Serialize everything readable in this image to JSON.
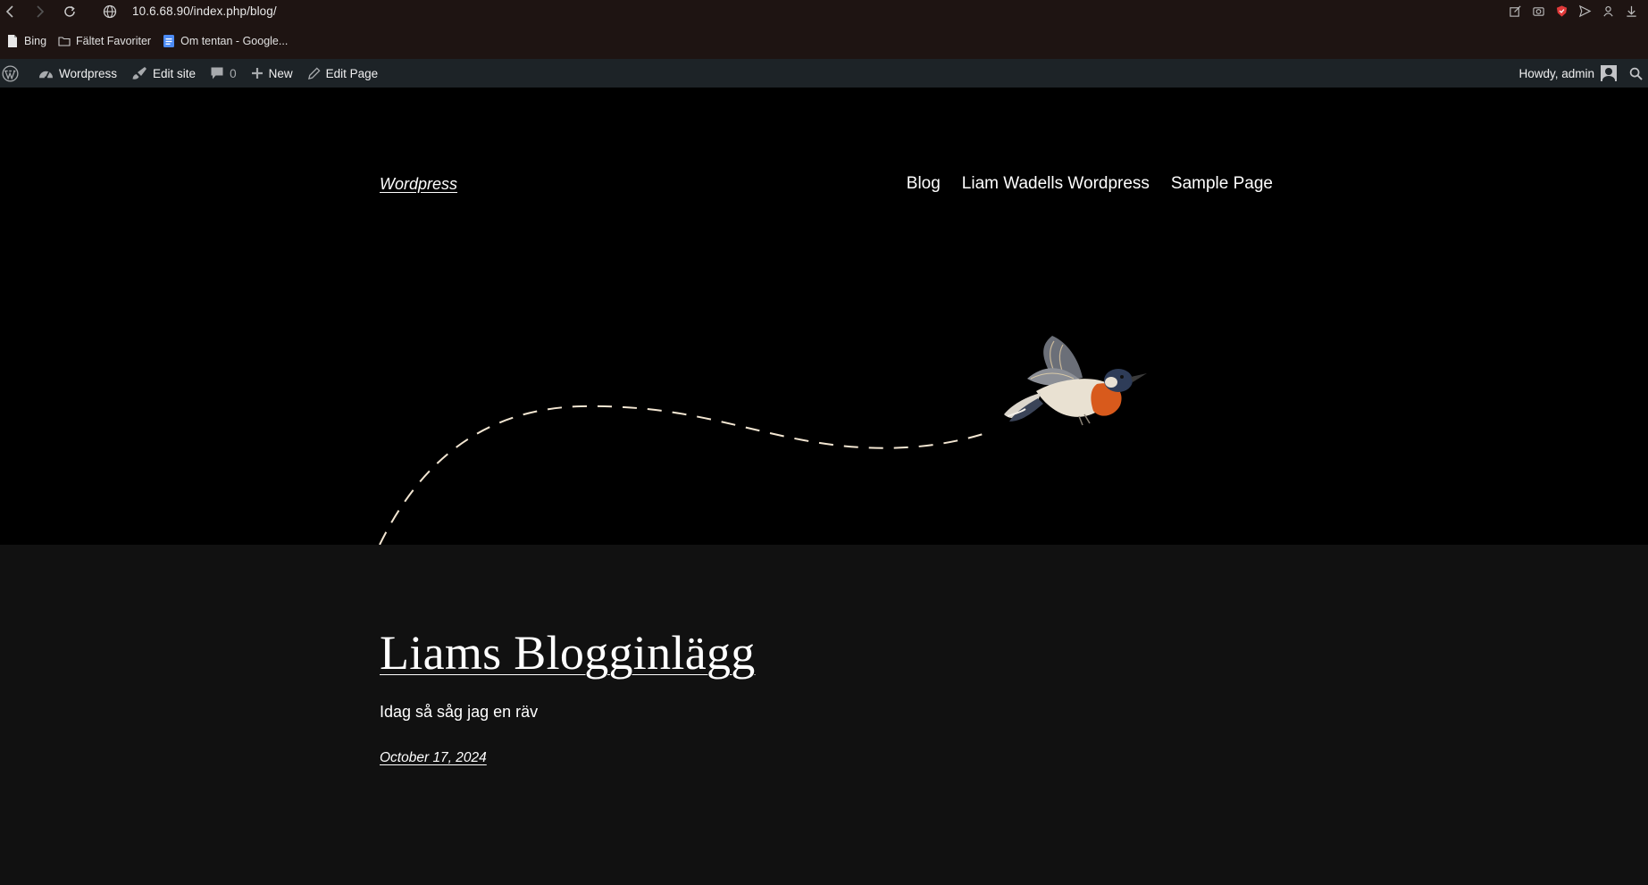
{
  "browser": {
    "url": "10.6.68.90/index.php/blog/",
    "bookmarks": [
      {
        "label": "Bing",
        "icon": "page-icon"
      },
      {
        "label": "Fältet Favoriter",
        "icon": "folder-icon"
      },
      {
        "label": "Om tentan - Google...",
        "icon": "google-docs-icon"
      }
    ]
  },
  "adminbar": {
    "site_name": "Wordpress",
    "edit_site": "Edit site",
    "comments_count": "0",
    "new_label": "New",
    "edit_page": "Edit Page",
    "howdy": "Howdy, admin"
  },
  "site": {
    "title": "Wordpress",
    "nav": [
      "Blog",
      "Liam Wadells Wordpress",
      "Sample Page"
    ]
  },
  "post": {
    "title": "Liams Blogginlägg",
    "excerpt": "Idag så såg jag en räv",
    "date": "October 17, 2024"
  },
  "colors": {
    "chrome_bg": "#1e1412",
    "adminbar_bg": "#1d2327",
    "header_bg": "#000000",
    "content_bg": "#111111",
    "dash_color": "#f3e6d2"
  }
}
